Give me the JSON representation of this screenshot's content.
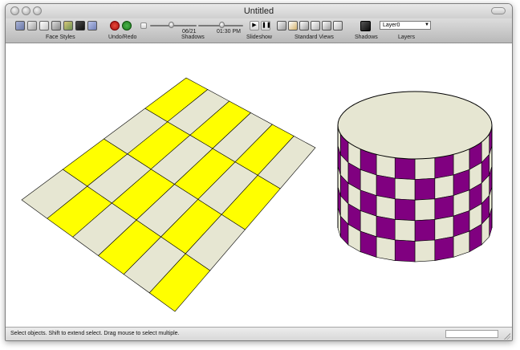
{
  "window": {
    "title": "Untitled"
  },
  "toolbar": {
    "face_styles_label": "Face Styles",
    "undo_redo_label": "Undo/Redo",
    "shadows_label": "Shadows",
    "slideshow_label": "Slideshow",
    "standard_views_label": "Standard Views",
    "shadows_toggle_label": "Shadows",
    "layers_label": "Layers",
    "shadow_date": "06/21",
    "shadow_time": "01:30 PM",
    "layer_selected": "Layer0"
  },
  "status": {
    "message": "Select objects. Shift to extend select. Drag mouse to select multiple."
  },
  "colors": {
    "yellow_tile": "#ffff00",
    "beige_tile": "#e6e6d2",
    "purple_tile": "#800080",
    "edge": "#000000"
  }
}
